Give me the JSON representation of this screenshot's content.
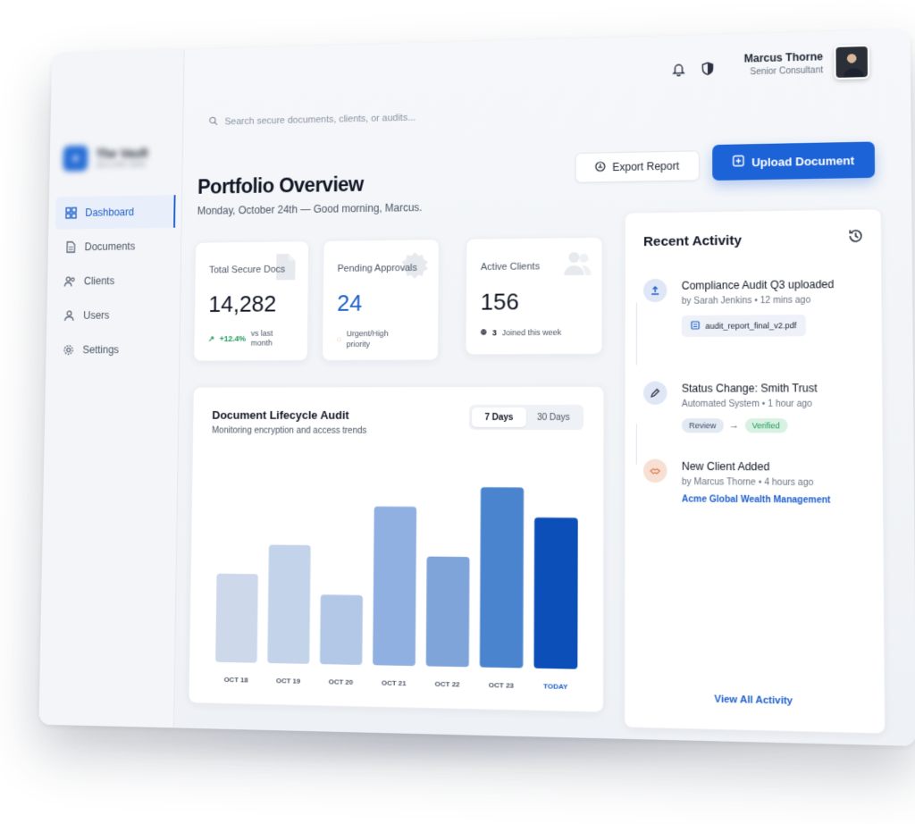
{
  "brand": {
    "name": "The Vault",
    "subtitle": "SECURE DMS"
  },
  "sidebar": {
    "items": [
      {
        "label": "Dashboard",
        "icon": "dashboard-icon",
        "active": true
      },
      {
        "label": "Documents",
        "icon": "document-icon",
        "active": false
      },
      {
        "label": "Clients",
        "icon": "clients-icon",
        "active": false
      },
      {
        "label": "Users",
        "icon": "user-icon",
        "active": false
      },
      {
        "label": "Settings",
        "icon": "gear-icon",
        "active": false
      }
    ]
  },
  "search": {
    "placeholder": "Search secure documents, clients, or audits..."
  },
  "user": {
    "name": "Marcus Thorne",
    "role": "Senior Consultant"
  },
  "header": {
    "title": "Portfolio Overview",
    "subtitle": "Monday, October 24th — Good morning, Marcus.",
    "export_label": "Export Report",
    "upload_label": "Upload Document"
  },
  "stats": [
    {
      "label": "Total Secure Docs",
      "value": "14,282",
      "delta": "+12.4%",
      "note": "vs last month"
    },
    {
      "label": "Pending Approvals",
      "value": "24",
      "note": "Urgent/High priority"
    },
    {
      "label": "Active Clients",
      "value": "156",
      "delta": "3",
      "note": "Joined this week"
    }
  ],
  "chart": {
    "title": "Document Lifecycle Audit",
    "subtitle": "Monitoring encryption and access trends",
    "ranges": [
      "7 Days",
      "30 Days"
    ],
    "selected_range": "7 Days"
  },
  "chart_data": {
    "type": "bar",
    "categories": [
      "OCT 18",
      "OCT 19",
      "OCT 20",
      "OCT 21",
      "OCT 22",
      "OCT 23",
      "TODAY"
    ],
    "values": [
      45,
      60,
      35,
      80,
      55,
      90,
      75
    ],
    "colors": [
      "#cdd9ea",
      "#c3d3ea",
      "#b3c8e6",
      "#8fb0e0",
      "#7ea4da",
      "#4a84cf",
      "#0d4fb8"
    ],
    "xlabel": "",
    "ylabel": "",
    "ylim": [
      0,
      100
    ]
  },
  "activity": {
    "title": "Recent Activity",
    "items": [
      {
        "title": "Compliance Audit Q3 uploaded",
        "meta": "by Sarah Jenkins • 12 mins ago",
        "file": "audit_report_final_v2.pdf",
        "icon": "upload-icon",
        "color": "#dfe6f6"
      },
      {
        "title": "Status Change: Smith Trust",
        "meta": "Automated System • 1 hour ago",
        "from": "Review",
        "to": "Verified",
        "icon": "pencil-icon",
        "color": "#dfe6f6"
      },
      {
        "title": "New Client Added",
        "meta": "by Marcus Thorne • 4 hours ago",
        "link": "Acme Global Wealth Management",
        "icon": "handshake-icon",
        "color": "#f7dfd3"
      }
    ],
    "view_all": "View All Activity"
  }
}
